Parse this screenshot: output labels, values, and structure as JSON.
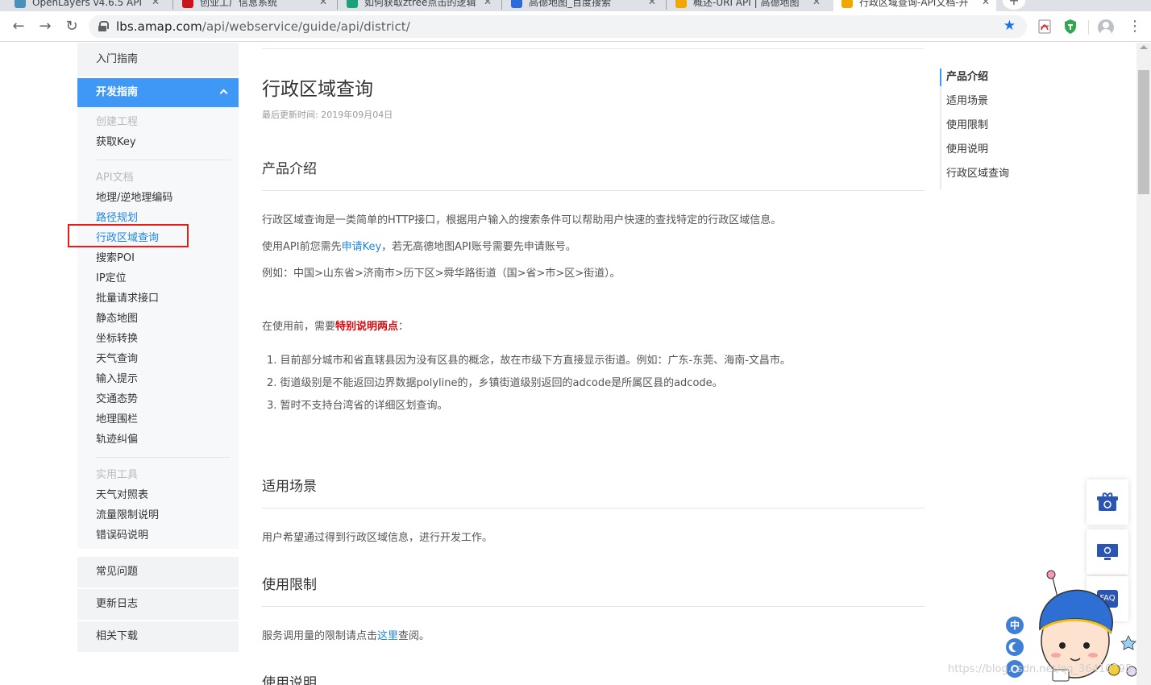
{
  "browser": {
    "tabs": [
      {
        "title": "OpenLayers v4.6.5 API"
      },
      {
        "title": "创业工厂信息系统"
      },
      {
        "title": "如何获取ztree点击的逻辑"
      },
      {
        "title": "高德地图_百度搜索"
      },
      {
        "title": "概述-URI API | 高德地图"
      },
      {
        "title": "行政区域查询-API文档-开"
      }
    ],
    "url_host": "lbs.amap.com",
    "url_path": "/api/webservice/guide/api/district/"
  },
  "sidenav": {
    "intro": "入门指南",
    "dev_guide": "开发指南",
    "cat_project": "创建工程",
    "get_key": "获取Key",
    "cat_api": "API文档",
    "api_items": [
      "地理/逆地理编码",
      "路径规划",
      "行政区域查询",
      "搜索POI",
      "IP定位",
      "批量请求接口",
      "静态地图",
      "坐标转换",
      "天气查询",
      "输入提示",
      "交通态势",
      "地理围栏",
      "轨迹纠偏"
    ],
    "cat_tools": "实用工具",
    "tool_items": [
      "天气对照表",
      "流量限制说明",
      "错误码说明"
    ],
    "faq": "常见问题",
    "changelog": "更新日志",
    "downloads": "相关下载"
  },
  "main": {
    "title": "行政区域查询",
    "updated": "最后更新时间: 2019年09月04日",
    "s1_title": "产品介绍",
    "s1_p1": "行政区域查询是一类简单的HTTP接口，根据用户输入的搜索条件可以帮助用户快速的查找特定的行政区域信息。",
    "s1_p2_pre": "使用API前您需先",
    "s1_p2_link": "申请Key",
    "s1_p2_post": "，若无高德地图API账号需要先申请账号。",
    "s1_p3": "例如：中国>山东省>济南市>历下区>舜华路街道（国>省>市>区>街道）。",
    "s1_p4_pre": "在使用前，需要",
    "s1_p4_strong": "特别说明两点",
    "s1_p4_post": "：",
    "s1_list": [
      "1. 目前部分城市和省直辖县因为没有区县的概念，故在市级下方直接显示街道。例如：广东-东莞、海南-文昌市。",
      "2. 街道级别是不能返回边界数据polyline的，乡镇街道级别返回的adcode是所属区县的adcode。",
      "3. 暂时不支持台湾省的详细区划查询。"
    ],
    "s2_title": "适用场景",
    "s2_p1": "用户希望通过得到行政区域信息，进行开发工作。",
    "s3_title": "使用限制",
    "s3_p1_pre": "服务调用量的限制请点击",
    "s3_p1_link": "这里",
    "s3_p1_post": "查阅。",
    "s4_title": "使用说明"
  },
  "toc": [
    "产品介绍",
    "适用场景",
    "使用限制",
    "使用说明",
    "行政区域查询"
  ],
  "widgets": {
    "faq_label": "FAQ",
    "lang_zh": "中",
    "watermark": "https://blog.csdn.net/qq_36410795"
  },
  "colors": {
    "accent": "#3f98f5",
    "link": "#1e86e0",
    "highlight_red": "#e0201b",
    "strong_red": "#d7090e"
  }
}
